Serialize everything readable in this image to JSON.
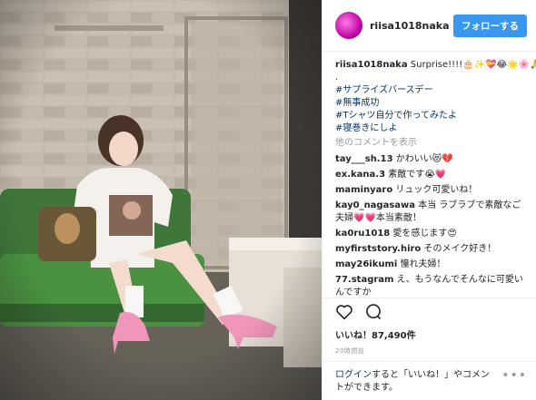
{
  "header": {
    "username": "riisa1018naka",
    "follow_label": "フォローする"
  },
  "caption": {
    "author": "riisa1018naka",
    "text": " Surprise!!!!🎂✨💝😂🌟🌸🙏",
    "dot": ".",
    "hashtags": [
      "#サプライズバースデー",
      "#無事成功",
      "#Tシャツ自分で作ってみたよ",
      "#寝巻きにしよ"
    ]
  },
  "more_comments": "他のコメントを表示",
  "comments": [
    {
      "user": "tay___sh.13",
      "text": " かわいい😻💔"
    },
    {
      "user": "ex.kana.3",
      "text": " 素敵です😭💗"
    },
    {
      "user": "maminyaro",
      "text": " リュック可愛いね！"
    },
    {
      "user": "kay0_nagasawa",
      "text": " 本当 ラブラブで素敵なご夫婦💗💗本当素敵！"
    },
    {
      "user": "ka0ru1018",
      "text": " 愛を感じます😍"
    },
    {
      "user": "myfirststory.hiro",
      "text": " そのメイク好き！"
    },
    {
      "user": "may26ikumi",
      "text": " 憧れ夫婦！"
    },
    {
      "user": "77.stagram",
      "text": " え、もうなんでそんなに可愛いんですか"
    }
  ],
  "actions": {
    "like_icon": "heart-icon",
    "comment_icon": "comment-icon",
    "likes_text": "いいね！87,490件",
    "time": "20時間前"
  },
  "login": {
    "link": "ログイン",
    "text": "すると「いいね！」やコメントができます。",
    "more_icon": "more-options-icon"
  }
}
